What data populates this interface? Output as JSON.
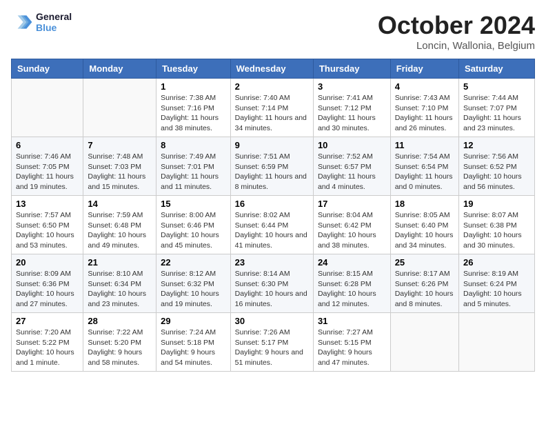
{
  "header": {
    "logo_line1": "General",
    "logo_line2": "Blue",
    "month_title": "October 2024",
    "location": "Loncin, Wallonia, Belgium"
  },
  "days_of_week": [
    "Sunday",
    "Monday",
    "Tuesday",
    "Wednesday",
    "Thursday",
    "Friday",
    "Saturday"
  ],
  "weeks": [
    [
      {
        "day": "",
        "detail": ""
      },
      {
        "day": "",
        "detail": ""
      },
      {
        "day": "1",
        "detail": "Sunrise: 7:38 AM\nSunset: 7:16 PM\nDaylight: 11 hours and 38 minutes."
      },
      {
        "day": "2",
        "detail": "Sunrise: 7:40 AM\nSunset: 7:14 PM\nDaylight: 11 hours and 34 minutes."
      },
      {
        "day": "3",
        "detail": "Sunrise: 7:41 AM\nSunset: 7:12 PM\nDaylight: 11 hours and 30 minutes."
      },
      {
        "day": "4",
        "detail": "Sunrise: 7:43 AM\nSunset: 7:10 PM\nDaylight: 11 hours and 26 minutes."
      },
      {
        "day": "5",
        "detail": "Sunrise: 7:44 AM\nSunset: 7:07 PM\nDaylight: 11 hours and 23 minutes."
      }
    ],
    [
      {
        "day": "6",
        "detail": "Sunrise: 7:46 AM\nSunset: 7:05 PM\nDaylight: 11 hours and 19 minutes."
      },
      {
        "day": "7",
        "detail": "Sunrise: 7:48 AM\nSunset: 7:03 PM\nDaylight: 11 hours and 15 minutes."
      },
      {
        "day": "8",
        "detail": "Sunrise: 7:49 AM\nSunset: 7:01 PM\nDaylight: 11 hours and 11 minutes."
      },
      {
        "day": "9",
        "detail": "Sunrise: 7:51 AM\nSunset: 6:59 PM\nDaylight: 11 hours and 8 minutes."
      },
      {
        "day": "10",
        "detail": "Sunrise: 7:52 AM\nSunset: 6:57 PM\nDaylight: 11 hours and 4 minutes."
      },
      {
        "day": "11",
        "detail": "Sunrise: 7:54 AM\nSunset: 6:54 PM\nDaylight: 11 hours and 0 minutes."
      },
      {
        "day": "12",
        "detail": "Sunrise: 7:56 AM\nSunset: 6:52 PM\nDaylight: 10 hours and 56 minutes."
      }
    ],
    [
      {
        "day": "13",
        "detail": "Sunrise: 7:57 AM\nSunset: 6:50 PM\nDaylight: 10 hours and 53 minutes."
      },
      {
        "day": "14",
        "detail": "Sunrise: 7:59 AM\nSunset: 6:48 PM\nDaylight: 10 hours and 49 minutes."
      },
      {
        "day": "15",
        "detail": "Sunrise: 8:00 AM\nSunset: 6:46 PM\nDaylight: 10 hours and 45 minutes."
      },
      {
        "day": "16",
        "detail": "Sunrise: 8:02 AM\nSunset: 6:44 PM\nDaylight: 10 hours and 41 minutes."
      },
      {
        "day": "17",
        "detail": "Sunrise: 8:04 AM\nSunset: 6:42 PM\nDaylight: 10 hours and 38 minutes."
      },
      {
        "day": "18",
        "detail": "Sunrise: 8:05 AM\nSunset: 6:40 PM\nDaylight: 10 hours and 34 minutes."
      },
      {
        "day": "19",
        "detail": "Sunrise: 8:07 AM\nSunset: 6:38 PM\nDaylight: 10 hours and 30 minutes."
      }
    ],
    [
      {
        "day": "20",
        "detail": "Sunrise: 8:09 AM\nSunset: 6:36 PM\nDaylight: 10 hours and 27 minutes."
      },
      {
        "day": "21",
        "detail": "Sunrise: 8:10 AM\nSunset: 6:34 PM\nDaylight: 10 hours and 23 minutes."
      },
      {
        "day": "22",
        "detail": "Sunrise: 8:12 AM\nSunset: 6:32 PM\nDaylight: 10 hours and 19 minutes."
      },
      {
        "day": "23",
        "detail": "Sunrise: 8:14 AM\nSunset: 6:30 PM\nDaylight: 10 hours and 16 minutes."
      },
      {
        "day": "24",
        "detail": "Sunrise: 8:15 AM\nSunset: 6:28 PM\nDaylight: 10 hours and 12 minutes."
      },
      {
        "day": "25",
        "detail": "Sunrise: 8:17 AM\nSunset: 6:26 PM\nDaylight: 10 hours and 8 minutes."
      },
      {
        "day": "26",
        "detail": "Sunrise: 8:19 AM\nSunset: 6:24 PM\nDaylight: 10 hours and 5 minutes."
      }
    ],
    [
      {
        "day": "27",
        "detail": "Sunrise: 7:20 AM\nSunset: 5:22 PM\nDaylight: 10 hours and 1 minute."
      },
      {
        "day": "28",
        "detail": "Sunrise: 7:22 AM\nSunset: 5:20 PM\nDaylight: 9 hours and 58 minutes."
      },
      {
        "day": "29",
        "detail": "Sunrise: 7:24 AM\nSunset: 5:18 PM\nDaylight: 9 hours and 54 minutes."
      },
      {
        "day": "30",
        "detail": "Sunrise: 7:26 AM\nSunset: 5:17 PM\nDaylight: 9 hours and 51 minutes."
      },
      {
        "day": "31",
        "detail": "Sunrise: 7:27 AM\nSunset: 5:15 PM\nDaylight: 9 hours and 47 minutes."
      },
      {
        "day": "",
        "detail": ""
      },
      {
        "day": "",
        "detail": ""
      }
    ]
  ]
}
